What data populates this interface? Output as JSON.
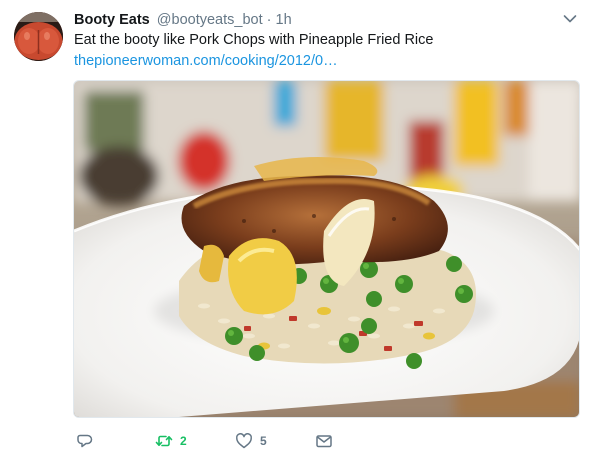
{
  "tweet": {
    "display_name": "Booty Eats",
    "handle": "@bootyeats_bot",
    "separator": "·",
    "time": "1h",
    "text": "Eat the booty like Pork Chops with Pineapple Fried Rice",
    "link": "thepioneerwoman.com/cooking/2012/0…",
    "image_alt": "Pork chop over pineapple fried rice with peas on a white plate"
  },
  "actions": {
    "reply_icon": "reply-icon",
    "retweet_icon": "retweet-icon",
    "retweet_count": "2",
    "like_icon": "heart-icon",
    "like_count": "5",
    "dm_icon": "envelope-icon"
  },
  "colors": {
    "link": "#1b95e0",
    "retweet_active": "#17bf63",
    "muted": "#657786"
  }
}
